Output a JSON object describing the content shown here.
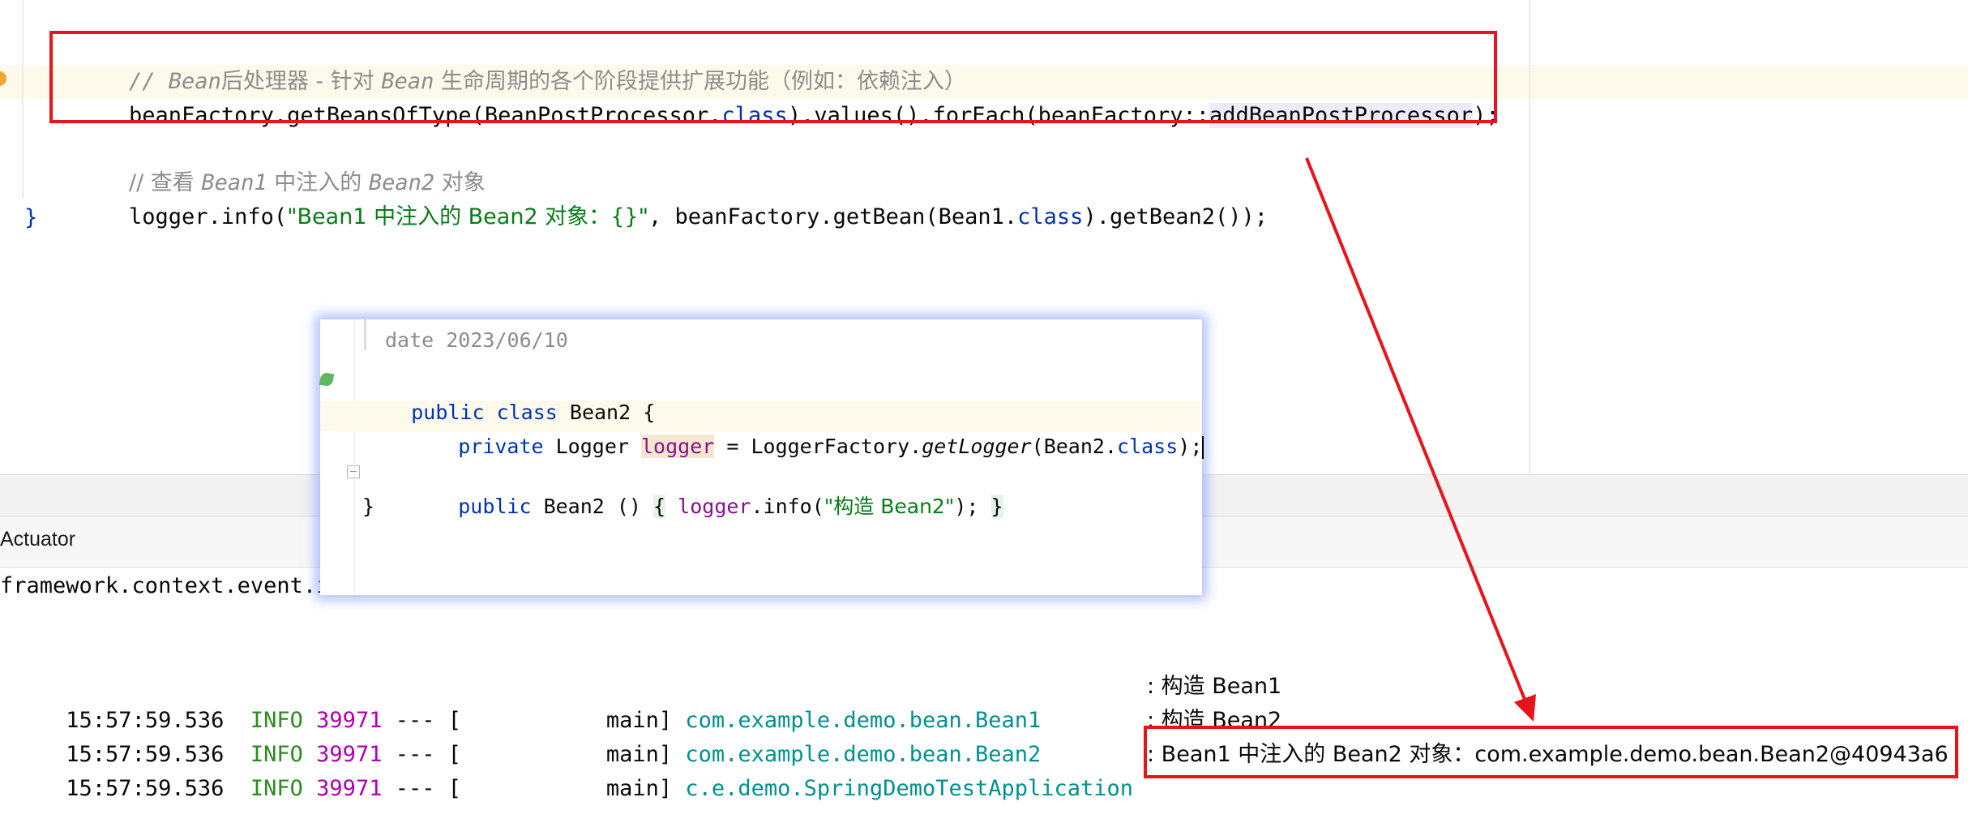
{
  "editor": {
    "comment1_prefix": "// Bean",
    "comment1_cn1": "后处理器",
    "comment1_mid": " - 针对 ",
    "comment1_bean": "Bean",
    "comment1_cn2": " 生命周期的各个阶段提供扩展功能（例如：依赖注入）",
    "line2": {
      "p1": "beanFactory.getBeansOfType(BeanPostProcessor.",
      "kw_class": "class",
      "p2": ").values().forEach(beanFactory::",
      "method_ref": "addBeanPostProcessor",
      "p3": ");"
    },
    "comment2_prefix": "// 查看 ",
    "comment2_bean1": "Bean1",
    "comment2_mid": " 中注入的 ",
    "comment2_bean2": "Bean2",
    "comment2_suffix": " 对象",
    "line4": {
      "p1": "logger.info(",
      "str": "\"Bean1 中注入的 Bean2 对象：{}\"",
      "p2": ", beanFactory.getBean(Bean1.",
      "kw_class": "class",
      "p3": ").getBean2());"
    },
    "closing_brace": "}"
  },
  "popup": {
    "doc_line": "date 2023/06/10",
    "l1_kw": "public class",
    "l1_name": " Bean2 {",
    "l2_kw": "private",
    "l2_type": " Logger ",
    "l2_field": "logger",
    "l2_rest1": " = LoggerFactory.",
    "l2_method": "getLogger",
    "l2_rest2": "(Bean2.",
    "l2_class": "class",
    "l2_end": ");",
    "l3_kw": "public",
    "l3_ctor": " Bean2 () ",
    "l3_brace": "{",
    "l3_field": " logger",
    "l3_mid": ".info(",
    "l3_str": "\"构造 Bean2\"",
    "l3_end": "); ",
    "l3_close": "}",
    "l4": "}"
  },
  "toolwindow": {
    "tab_label": "Actuator",
    "partial_line": "framework.context.event.i"
  },
  "console": {
    "rows": [
      {
        "time": " 15:57:59.536",
        "level": "INFO",
        "pid": "39971",
        "sep": " --- [",
        "thread": "main]",
        "logger": "com.example.demo.bean.Bean1",
        "message": ": 构造 Bean1"
      },
      {
        "time": " 15:57:59.536",
        "level": "INFO",
        "pid": "39971",
        "sep": " --- [",
        "thread": "main]",
        "logger": "com.example.demo.bean.Bean2",
        "message": ": 构造 Bean2"
      },
      {
        "time": " 15:57:59.536",
        "level": "INFO",
        "pid": "39971",
        "sep": " --- [",
        "thread": "main]",
        "logger": "c.e.demo.SpringDemoTestApplication",
        "message": ": Bean1 中注入的 Bean2 对象：com.example.demo.bean.Bean2@40943a6"
      }
    ]
  },
  "colors": {
    "annotation_red": "#e8141a",
    "popup_glow": "#6e8cff"
  }
}
